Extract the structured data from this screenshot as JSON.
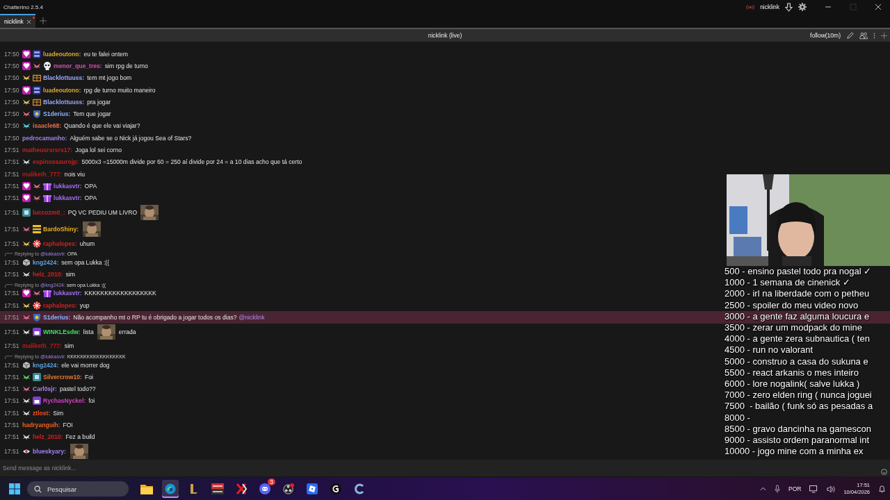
{
  "window": {
    "title": "Chatterino 2.5.4",
    "account": "nicklink"
  },
  "tabs": [
    {
      "label": "nicklink",
      "selected": true,
      "unread": true
    }
  ],
  "split": {
    "title": "nicklink (live)",
    "follow_mode": "follow(10m)",
    "input_placeholder": "Send message as nicklink..."
  },
  "messages": [
    {
      "time": "17:50",
      "badges": [
        {
          "kind": "gem"
        },
        {
          "kind": "calendar"
        }
      ],
      "user": "luadeoutono:",
      "color": "#d8a838",
      "highlighted": false,
      "parts": [
        {
          "kind": "text",
          "text": "eu te falei ontem"
        }
      ]
    },
    {
      "time": "17:50",
      "badges": [
        {
          "kind": "gem"
        },
        {
          "kind": "fairy",
          "color": "#e0708a"
        },
        {
          "kind": "skull"
        }
      ],
      "user": "menor_que_tres:",
      "color": "#d050b0",
      "highlighted": false,
      "parts": [
        {
          "kind": "text",
          "text": "sim rpg de turno"
        }
      ]
    },
    {
      "time": "17:50",
      "badges": [
        {
          "kind": "fairy",
          "color": "#e8c060"
        },
        {
          "kind": "chest"
        }
      ],
      "user": "Blacklottuuss:",
      "color": "#9aa8ff",
      "highlighted": false,
      "parts": [
        {
          "kind": "text",
          "text": "tem mt jogo bom"
        }
      ]
    },
    {
      "time": "17:50",
      "badges": [
        {
          "kind": "gem"
        },
        {
          "kind": "calendar"
        }
      ],
      "user": "luadeoutono:",
      "color": "#d8a838",
      "highlighted": false,
      "parts": [
        {
          "kind": "text",
          "text": "rpg de turno muito maneiro"
        }
      ]
    },
    {
      "time": "17:50",
      "badges": [
        {
          "kind": "fairy",
          "color": "#e8c060"
        },
        {
          "kind": "chest"
        }
      ],
      "user": "Blacklottuuss:",
      "color": "#9aa8ff",
      "highlighted": false,
      "parts": [
        {
          "kind": "text",
          "text": "pra jogar"
        }
      ]
    },
    {
      "time": "17:50",
      "badges": [
        {
          "kind": "fairy",
          "color": "#e0708a"
        },
        {
          "kind": "shield"
        }
      ],
      "user": "S1derius:",
      "color": "#8ab4ff",
      "highlighted": false,
      "parts": [
        {
          "kind": "text",
          "text": "Tem que jogar"
        }
      ]
    },
    {
      "time": "17:50",
      "badges": [
        {
          "kind": "fairy",
          "color": "#60d0e0"
        }
      ],
      "user": "isaacle68:",
      "color": "#e07050",
      "highlighted": false,
      "parts": [
        {
          "kind": "text",
          "text": "Quando é que ele vai viajar?"
        }
      ]
    },
    {
      "time": "17:50",
      "user": "pedrocamanho:",
      "color": "#a080e0",
      "highlighted": false,
      "parts": [
        {
          "kind": "text",
          "text": "Alguém sabe se o Nick já jogou Sea of Stars?"
        }
      ]
    },
    {
      "time": "17:51",
      "user": "matheusrsrsrs17:",
      "color": "#c02020",
      "highlighted": false,
      "parts": [
        {
          "kind": "text",
          "text": "Joga lol sei corno"
        }
      ]
    },
    {
      "time": "17:51",
      "badges": [
        {
          "kind": "fairy",
          "color": "#e0e0e8"
        }
      ],
      "user": "espinossaurojp:",
      "color": "#c02020",
      "highlighted": false,
      "parts": [
        {
          "kind": "text",
          "text": "5000x3 =15000m divide por 60 = 250 aí divide por 24 = a 10 dias acho que tá certo"
        }
      ]
    },
    {
      "time": "17:51",
      "user": "maliketh_777:",
      "color": "#c01818",
      "highlighted": false,
      "parts": [
        {
          "kind": "text",
          "text": "nois viu"
        }
      ]
    },
    {
      "time": "17:51",
      "badges": [
        {
          "kind": "gem"
        },
        {
          "kind": "fairy",
          "color": "#e0708a"
        },
        {
          "kind": "gift"
        }
      ],
      "user": "lukkasvtr:",
      "color": "#a070f0",
      "highlighted": false,
      "parts": [
        {
          "kind": "text",
          "text": "OPA"
        }
      ]
    },
    {
      "time": "17:51",
      "badges": [
        {
          "kind": "gem"
        },
        {
          "kind": "fairy",
          "color": "#e0708a"
        },
        {
          "kind": "gift"
        }
      ],
      "user": "lukkasvtr:",
      "color": "#a070f0",
      "highlighted": false,
      "parts": [
        {
          "kind": "text",
          "text": "OPA"
        }
      ]
    },
    {
      "time": "17:51",
      "badges": [
        {
          "kind": "tile"
        }
      ],
      "user": "luccozm0_:",
      "color": "#d02020",
      "highlighted": false,
      "parts": [
        {
          "kind": "text",
          "text": "PQ VC PEDIU UM LIVRO"
        },
        {
          "kind": "picture"
        }
      ]
    },
    {
      "time": "17:51",
      "badges": [
        {
          "kind": "fairy",
          "color": "#e0708a"
        },
        {
          "kind": "stripes"
        }
      ],
      "user": "BardoShiny:",
      "color": "#e8b020",
      "highlighted": false,
      "parts": [
        {
          "kind": "picture"
        }
      ]
    },
    {
      "time": "17:51",
      "badges": [
        {
          "kind": "fairy",
          "color": "#e8c060"
        },
        {
          "kind": "umbrella"
        }
      ],
      "user": "raphalopes:",
      "color": "#d02020",
      "highlighted": false,
      "parts": [
        {
          "kind": "text",
          "text": "uhum"
        }
      ]
    },
    {
      "time": "17:51",
      "reply": {
        "label": "Replying to",
        "user": "@lukkasvtr:",
        "text": "OPA"
      },
      "badges": [
        {
          "kind": "cube"
        }
      ],
      "user": "kng2424:",
      "color": "#5ea0e0",
      "highlighted": false,
      "parts": [
        {
          "kind": "text",
          "text": "sem opa Lukka :(("
        }
      ]
    },
    {
      "time": "17:51",
      "badges": [
        {
          "kind": "fairy",
          "color": "#e0e0e8"
        }
      ],
      "user": "helz_2010:",
      "color": "#d02020",
      "highlighted": false,
      "parts": [
        {
          "kind": "text",
          "text": "sim"
        }
      ]
    },
    {
      "time": "17:51",
      "reply": {
        "label": "Replying to",
        "user": "@kng2424:",
        "text": "sem opa Lukka :(("
      },
      "badges": [
        {
          "kind": "gem"
        },
        {
          "kind": "fairy",
          "color": "#e0708a"
        },
        {
          "kind": "gift"
        }
      ],
      "user": "lukkasvtr:",
      "color": "#a070f0",
      "highlighted": false,
      "parts": [
        {
          "kind": "text",
          "text": "KKKKKKKKKKKKKKKKKK"
        }
      ]
    },
    {
      "time": "17:51",
      "badges": [
        {
          "kind": "fairy",
          "color": "#e8c060"
        },
        {
          "kind": "umbrella"
        }
      ],
      "user": "raphalopes:",
      "color": "#d02020",
      "highlighted": false,
      "parts": [
        {
          "kind": "text",
          "text": "yup"
        }
      ]
    },
    {
      "time": "17:51",
      "badges": [
        {
          "kind": "fairy",
          "color": "#e0708a"
        },
        {
          "kind": "shield"
        }
      ],
      "user": "S1derius:",
      "color": "#8ab4ff",
      "highlighted": true,
      "parts": [
        {
          "kind": "text",
          "text": "Não acompanho mt o RP tu é obrigado a jogar todos os dias?"
        },
        {
          "kind": "mention",
          "text": "@nicklink"
        }
      ]
    },
    {
      "time": "17:51",
      "badges": [
        {
          "kind": "fairy",
          "color": "#e0e0e8"
        },
        {
          "kind": "cake"
        }
      ],
      "user": "WINKLEsdw:",
      "color": "#40e060",
      "highlighted": false,
      "parts": [
        {
          "kind": "text",
          "text": "lista"
        },
        {
          "kind": "picture"
        },
        {
          "kind": "text",
          "text": "errada"
        }
      ]
    },
    {
      "time": "17:51",
      "user": "maliketh_777:",
      "color": "#c01818",
      "highlighted": false,
      "parts": [
        {
          "kind": "text",
          "text": "sim"
        }
      ]
    },
    {
      "time": "17:51",
      "reply": {
        "label": "Replying to",
        "user": "@lukkasvtr:",
        "text": "KKKKKKKKKKKKKKKKKK"
      },
      "badges": [
        {
          "kind": "cube"
        }
      ],
      "user": "kng2424:",
      "color": "#5ea0e0",
      "highlighted": false,
      "parts": [
        {
          "kind": "text",
          "text": "ele vai morrer dog"
        }
      ]
    },
    {
      "time": "17:51",
      "badges": [
        {
          "kind": "fairy",
          "color": "#60d060"
        },
        {
          "kind": "tile"
        }
      ],
      "user": "Silvercrow10:",
      "color": "#e87830",
      "highlighted": false,
      "parts": [
        {
          "kind": "text",
          "text": "Foi"
        }
      ]
    },
    {
      "time": "17:51",
      "badges": [
        {
          "kind": "fairy",
          "color": "#e0708a"
        }
      ],
      "user": "Carl0sjr:",
      "color": "#b080f0",
      "highlighted": false,
      "parts": [
        {
          "kind": "text",
          "text": "pastel todo??"
        }
      ]
    },
    {
      "time": "17:51",
      "badges": [
        {
          "kind": "fairy",
          "color": "#e0e0e8"
        },
        {
          "kind": "cake"
        }
      ],
      "user": "RychasNyckel:",
      "color": "#d040c0",
      "highlighted": false,
      "parts": [
        {
          "kind": "text",
          "text": "foi"
        }
      ]
    },
    {
      "time": "17:51",
      "badges": [
        {
          "kind": "fairy",
          "color": "#e0e0e8"
        }
      ],
      "user": "ztlost:",
      "color": "#f05020",
      "highlighted": false,
      "parts": [
        {
          "kind": "text",
          "text": "Sim"
        }
      ]
    },
    {
      "time": "17:51",
      "user": "hadryanguih:",
      "color": "#f06020",
      "highlighted": false,
      "parts": [
        {
          "kind": "text",
          "text": "FOI"
        }
      ]
    },
    {
      "time": "17:51",
      "badges": [
        {
          "kind": "fairy",
          "color": "#e0e0e8"
        }
      ],
      "user": "helz_2010:",
      "color": "#d02020",
      "highlighted": false,
      "parts": [
        {
          "kind": "text",
          "text": "Fez a build"
        }
      ]
    },
    {
      "time": "17:51",
      "badges": [
        {
          "kind": "eye"
        }
      ],
      "user": "blueskyary:",
      "color": "#a080f0",
      "highlighted": false,
      "parts": [
        {
          "kind": "picture"
        }
      ]
    }
  ],
  "overlay": {
    "goals": [
      "500 - ensino pastel todo pra nogal ✓",
      "1000 - 1 semana de cinenick ✓",
      "2000 - irl na liberdade com o petheu",
      "2500 - spoiler do meu video novo",
      "3000 - a gente faz alguma loucura e",
      "3500 - zerar um modpack do mine",
      "4000 - a gente zera subnautica ( ten",
      "4500 - run no valorant",
      "5000 - construo a casa do sukuna e",
      "5500 - react arkanis o mes inteiro",
      "6000 - lore nogalink( salve lukka )",
      "7000 - zero elden ring ( nunca joguei",
      "7500  - bailão ( funk só as pesadas a",
      "8000 -",
      "8500 - gravo dancinha na gamescon",
      "9000 - assisto ordem paranormal int",
      "10000 - jogo mine com a minha ex"
    ]
  },
  "taskbar": {
    "search_placeholder": "Pesquisar",
    "apps": [
      {
        "kind": "folder",
        "active": false
      },
      {
        "kind": "edge",
        "active": true
      },
      {
        "kind": "league",
        "active": false
      },
      {
        "kind": "mixer",
        "active": false
      },
      {
        "kind": "xmark",
        "active": false
      },
      {
        "kind": "discord",
        "active": false,
        "badge": "3"
      },
      {
        "kind": "obs",
        "active": false
      },
      {
        "kind": "roblox",
        "active": false
      },
      {
        "kind": "logi",
        "active": false
      },
      {
        "kind": "chatterino",
        "active": false
      }
    ],
    "language": "POR",
    "time": "17:51",
    "date": "10/04/2026"
  }
}
